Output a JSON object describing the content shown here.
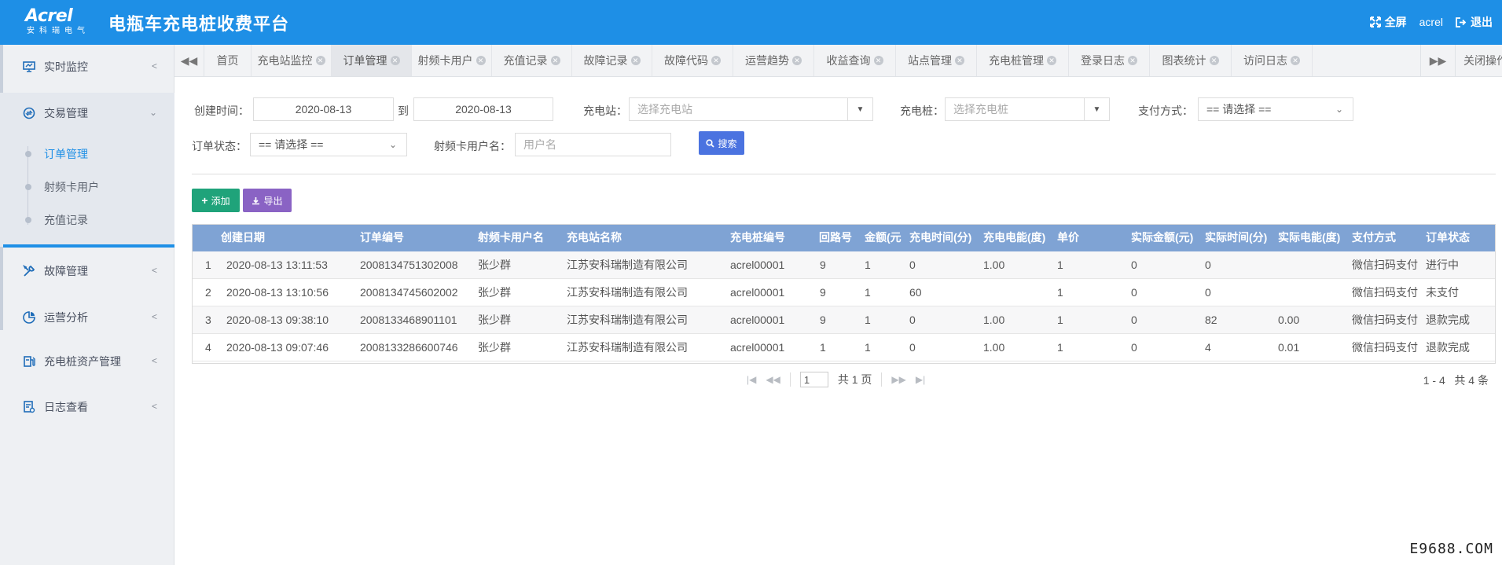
{
  "brand": {
    "logo_name": "Acrel",
    "logo_sub": "安科瑞电气",
    "app_title": "电瓶车充电桩收费平台",
    "color": "#1e8fe6"
  },
  "header": {
    "fullscreen_label": "全屏",
    "user": "acrel",
    "logout_label": "退出"
  },
  "sidebar": {
    "menus": [
      {
        "label": "实时监控",
        "icon": "monitor-icon"
      },
      {
        "label": "交易管理",
        "icon": "trade-icon"
      },
      {
        "label": "故障管理",
        "icon": "tools-icon"
      },
      {
        "label": "运营分析",
        "icon": "chart-icon"
      },
      {
        "label": "充电桩资产管理",
        "icon": "charger-icon"
      },
      {
        "label": "日志查看",
        "icon": "log-icon"
      }
    ],
    "submenus": [
      {
        "label": "订单管理",
        "active": true
      },
      {
        "label": "射频卡用户"
      },
      {
        "label": "充值记录"
      }
    ]
  },
  "tabs": {
    "items": [
      "首页",
      "充电站监控",
      "订单管理",
      "射频卡用户",
      "充值记录",
      "故障记录",
      "故障代码",
      "运营趋势",
      "收益查询",
      "站点管理",
      "充电桩管理",
      "登录日志",
      "图表统计",
      "访问日志"
    ],
    "active": "订单管理",
    "close_ops": "关闭操作"
  },
  "filters": {
    "create_time_label": "创建时间：",
    "date_from": "2020-08-13",
    "to_label": "到",
    "date_to": "2020-08-13",
    "station_label": "充电站：",
    "station_placeholder": "选择充电站",
    "pile_label": "充电桩：",
    "pile_placeholder": "选择充电桩",
    "pay_label": "支付方式：",
    "pay_value": "== 请选择 ==",
    "status_label": "订单状态：",
    "status_value": "== 请选择 ==",
    "card_user_label": "射频卡用户名：",
    "card_user_placeholder": "用户名",
    "search_label": "搜索"
  },
  "toolbar": {
    "add_label": "添加",
    "export_label": "导出"
  },
  "table": {
    "columns": [
      "",
      "创建日期",
      "订单编号",
      "射频卡用户名",
      "充电站名称",
      "充电桩编号",
      "回路号",
      "金额(元",
      "充电时间(分)",
      "充电电能(度)",
      "单价",
      "实际金额(元)",
      "实际时间(分)",
      "实际电能(度)",
      "支付方式",
      "订单状态"
    ],
    "rows": [
      [
        "1",
        "2020-08-13 13:11:53",
        "2008134751302008",
        "张少群",
        "江苏安科瑞制造有限公司",
        "acrel00001",
        "9",
        "1",
        "0",
        "1.00",
        "1",
        "0",
        "0",
        "",
        "微信扫码支付",
        "进行中"
      ],
      [
        "2",
        "2020-08-13 13:10:56",
        "2008134745602002",
        "张少群",
        "江苏安科瑞制造有限公司",
        "acrel00001",
        "9",
        "1",
        "60",
        "",
        "1",
        "0",
        "0",
        "",
        "微信扫码支付",
        "未支付"
      ],
      [
        "3",
        "2020-08-13 09:38:10",
        "2008133468901101",
        "张少群",
        "江苏安科瑞制造有限公司",
        "acrel00001",
        "9",
        "1",
        "0",
        "1.00",
        "1",
        "0",
        "82",
        "0.00",
        "微信扫码支付",
        "退款完成"
      ],
      [
        "4",
        "2020-08-13 09:07:46",
        "2008133286600746",
        "张少群",
        "江苏安科瑞制造有限公司",
        "acrel00001",
        "1",
        "1",
        "0",
        "1.00",
        "1",
        "0",
        "4",
        "0.01",
        "微信扫码支付",
        "退款完成"
      ]
    ]
  },
  "pagination": {
    "current_page": "1",
    "total_pages_label": "共 1 页",
    "range_label": "1 - 4",
    "total_label": "共 4 条"
  },
  "watermark": "E9688.COM"
}
